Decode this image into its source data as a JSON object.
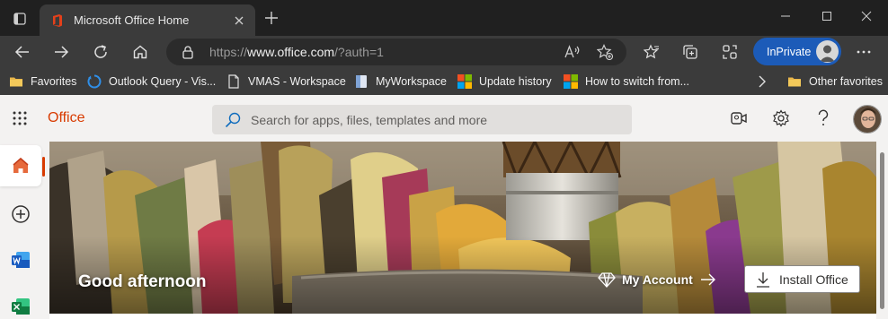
{
  "browser": {
    "tab": {
      "title": "Microsoft Office Home"
    },
    "address": {
      "scheme": "https://",
      "host": "www.office.com",
      "path": "/?auth=1"
    },
    "inprivate_label": "InPrivate",
    "favorites": [
      {
        "label": "Favorites",
        "icon": "folder-icon"
      },
      {
        "label": "Outlook Query - Vis...",
        "icon": "outlook-icon"
      },
      {
        "label": "VMAS - Workspace",
        "icon": "page-icon"
      },
      {
        "label": "MyWorkspace",
        "icon": "page-icon"
      },
      {
        "label": "Update history",
        "icon": "microsoft-logo-icon"
      },
      {
        "label": "How to switch from...",
        "icon": "microsoft-logo-icon"
      }
    ],
    "other_favorites": "Other favorites"
  },
  "office": {
    "brand": "Office",
    "search_placeholder": "Search for apps, files, templates and more",
    "greeting": "Good afternoon",
    "my_account": "My Account",
    "install_office": "Install Office",
    "rail": [
      "home-icon",
      "create-icon",
      "word-icon",
      "excel-icon"
    ]
  },
  "colors": {
    "office_accent": "#d83b01",
    "inprivate_blue": "#1c5bb8",
    "browser_dark": "#202020",
    "toolbar": "#3b3b3b"
  }
}
